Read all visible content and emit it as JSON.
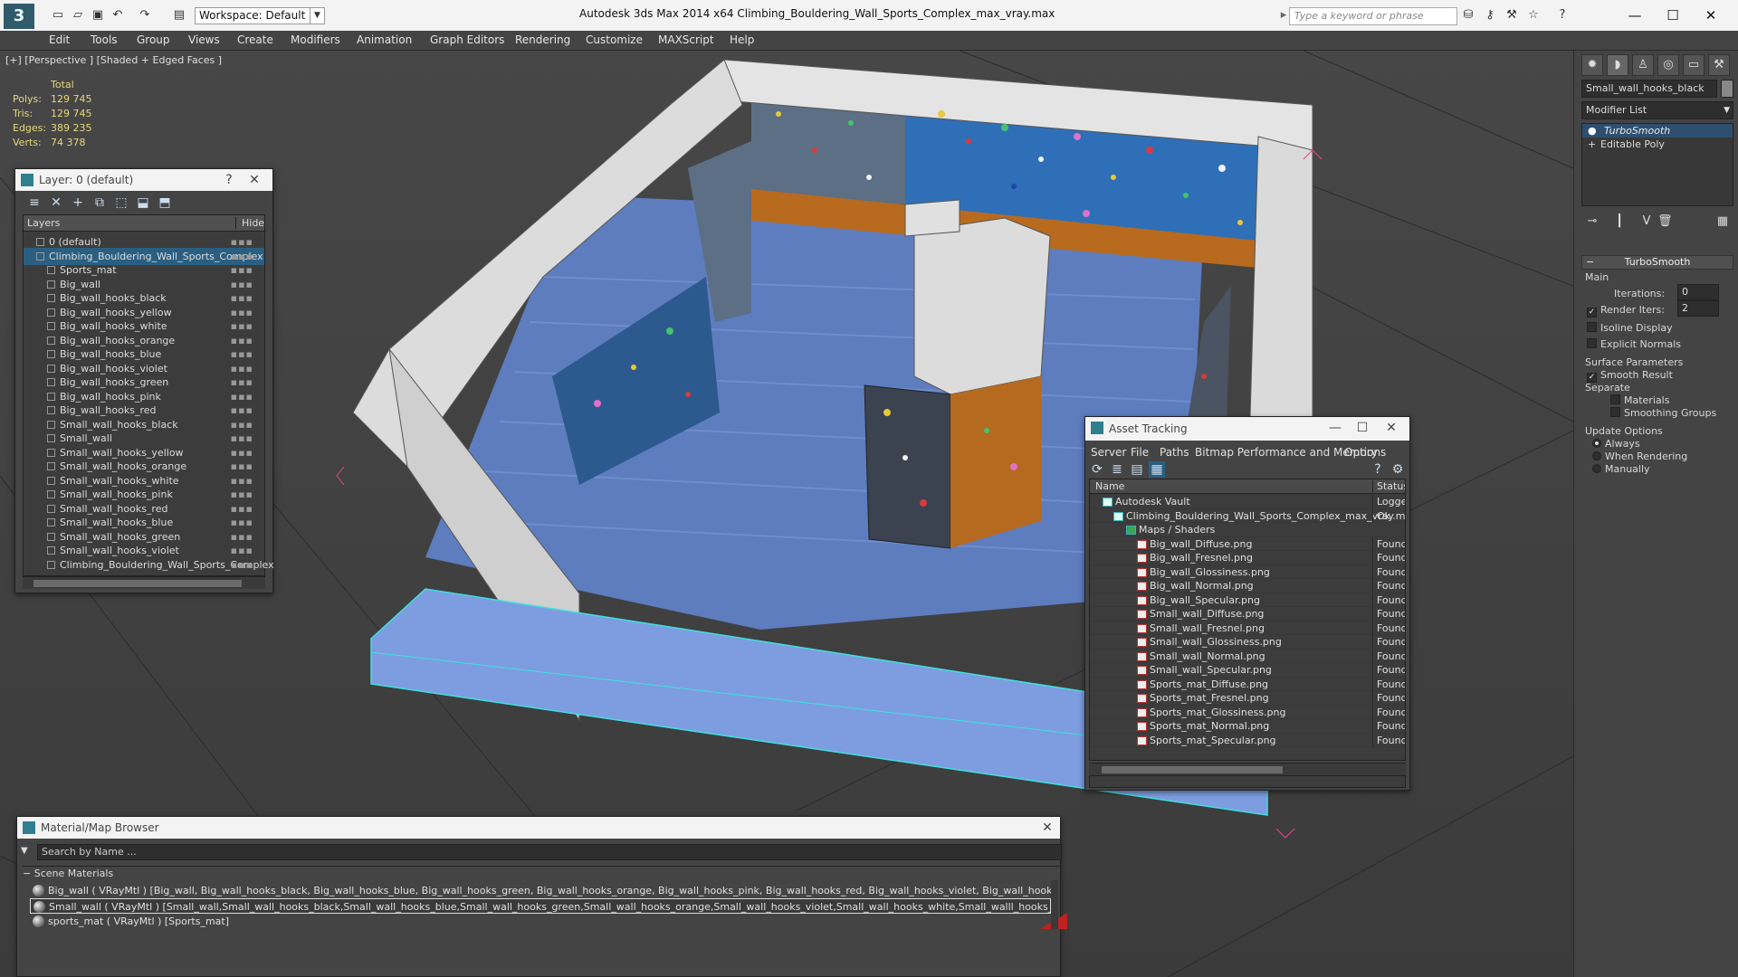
{
  "app": {
    "workspace": "Workspace: Default",
    "title": "Autodesk 3ds Max  2014 x64     Climbing_Bouldering_Wall_Sports_Complex_max_vray.max",
    "search_placeholder": "Type a keyword or phrase"
  },
  "menu": [
    "Edit",
    "Tools",
    "Group",
    "Views",
    "Create",
    "Modifiers",
    "Animation",
    "Graph Editors",
    "Rendering",
    "Customize",
    "MAXScript",
    "Help"
  ],
  "viewport": {
    "label": "[+] [Perspective ] [Shaded + Edged Faces ]",
    "stats": {
      "header": "Total",
      "rows": [
        {
          "label": "Polys:",
          "value": "129 745"
        },
        {
          "label": "Tris:",
          "value": "129 745"
        },
        {
          "label": "Edges:",
          "value": "389 235"
        },
        {
          "label": "Verts:",
          "value": "74 378"
        }
      ]
    }
  },
  "layers": {
    "title": "Layer: 0 (default)",
    "help": "?",
    "col_layers": "Layers",
    "col_hide": "Hide",
    "items": [
      {
        "name": "0 (default)",
        "level": 0
      },
      {
        "name": "Climbing_Bouldering_Wall_Sports_Complex",
        "level": 0,
        "selected": true
      },
      {
        "name": "Sports_mat",
        "level": 1
      },
      {
        "name": "Big_wall",
        "level": 1
      },
      {
        "name": "Big_wall_hooks_black",
        "level": 1
      },
      {
        "name": "Big_wall_hooks_yellow",
        "level": 1
      },
      {
        "name": "Big_wall_hooks_white",
        "level": 1
      },
      {
        "name": "Big_wall_hooks_orange",
        "level": 1
      },
      {
        "name": "Big_wall_hooks_blue",
        "level": 1
      },
      {
        "name": "Big_wall_hooks_violet",
        "level": 1
      },
      {
        "name": "Big_wall_hooks_green",
        "level": 1
      },
      {
        "name": "Big_wall_hooks_pink",
        "level": 1
      },
      {
        "name": "Big_wall_hooks_red",
        "level": 1
      },
      {
        "name": "Small_wall_hooks_black",
        "level": 1
      },
      {
        "name": "Small_wall",
        "level": 1
      },
      {
        "name": "Small_wall_hooks_yellow",
        "level": 1
      },
      {
        "name": "Small_wall_hooks_orange",
        "level": 1
      },
      {
        "name": "Small_wall_hooks_white",
        "level": 1
      },
      {
        "name": "Small_wall_hooks_pink",
        "level": 1
      },
      {
        "name": "Small_wall_hooks_red",
        "level": 1
      },
      {
        "name": "Small_wall_hooks_blue",
        "level": 1
      },
      {
        "name": "Small_wall_hooks_green",
        "level": 1
      },
      {
        "name": "Small_wall_hooks_violet",
        "level": 1
      },
      {
        "name": "Climbing_Bouldering_Wall_Sports_Complex",
        "level": 1
      }
    ]
  },
  "command_panel": {
    "object_name": "Small_wall_hooks_black",
    "modifier_list": "Modifier List",
    "stack": [
      "TurboSmooth",
      "Editable Poly"
    ],
    "rollout": "TurboSmooth",
    "main": "Main",
    "iterations_label": "Iterations:",
    "iterations": "0",
    "render_iters_label": "Render Iters:",
    "render_iters": "2",
    "isoline": "Isoline Display",
    "explicit": "Explicit Normals",
    "surface": "Surface Parameters",
    "smooth_result": "Smooth Result",
    "separate": "Separate",
    "materials": "Materials",
    "smoothing_groups": "Smoothing Groups",
    "update": "Update Options",
    "always": "Always",
    "when_rendering": "When Rendering",
    "manually": "Manually"
  },
  "material_browser": {
    "title": "Material/Map Browser",
    "search": "Search by Name ...",
    "group": "Scene Materials",
    "items": [
      "Big_wall  ( VRayMtl ) [Big_wall, Big_wall_hooks_black, Big_wall_hooks_blue, Big_wall_hooks_green, Big_wall_hooks_orange, Big_wall_hooks_pink, Big_wall_hooks_red, Big_wall_hooks_violet, Big_wall_hooks_white, Big_wall_hooks_yellow]",
      "Small_wall  ( VRayMtl ) [Small_wall,Small_wall_hooks_black,Small_wall_hooks_blue,Small_wall_hooks_green,Small_wall_hooks_orange,Small_wall_hooks_violet,Small_wall_hooks_white,Small_walll_hooks_pink,Small_walll_hooks_yellow,Smalll_wall_hooks_red]",
      "sports_mat  ( VRayMtl ) [Sports_mat]"
    ]
  },
  "asset_tracking": {
    "title": "Asset Tracking",
    "menu": [
      "Server",
      "File",
      "Paths",
      "Bitmap Performance and Memory",
      "Options"
    ],
    "col_name": "Name",
    "col_status": "Status",
    "rows": [
      {
        "name": "Autodesk Vault",
        "status": "Logged Out",
        "level": 1,
        "kind": "vault"
      },
      {
        "name": "Climbing_Bouldering_Wall_Sports_Complex_max_vray.max",
        "status": "Ok",
        "level": 2,
        "kind": "max"
      },
      {
        "name": "Maps / Shaders",
        "status": "",
        "level": 3,
        "kind": "folder"
      },
      {
        "name": "Big_wall_Diffuse.png",
        "status": "Found",
        "level": 4,
        "kind": "png"
      },
      {
        "name": "Big_wall_Fresnel.png",
        "status": "Found",
        "level": 4,
        "kind": "png"
      },
      {
        "name": "Big_wall_Glossiness.png",
        "status": "Found",
        "level": 4,
        "kind": "png"
      },
      {
        "name": "Big_wall_Normal.png",
        "status": "Found",
        "level": 4,
        "kind": "png"
      },
      {
        "name": "Big_wall_Specular.png",
        "status": "Found",
        "level": 4,
        "kind": "png"
      },
      {
        "name": "Small_wall_Diffuse.png",
        "status": "Found",
        "level": 4,
        "kind": "png"
      },
      {
        "name": "Small_wall_Fresnel.png",
        "status": "Found",
        "level": 4,
        "kind": "png"
      },
      {
        "name": "Small_wall_Glossiness.png",
        "status": "Found",
        "level": 4,
        "kind": "png"
      },
      {
        "name": "Small_wall_Normal.png",
        "status": "Found",
        "level": 4,
        "kind": "png"
      },
      {
        "name": "Small_wall_Specular.png",
        "status": "Found",
        "level": 4,
        "kind": "png"
      },
      {
        "name": "Sports_mat_Diffuse.png",
        "status": "Found",
        "level": 4,
        "kind": "png"
      },
      {
        "name": "Sports_mat_Fresnel.png",
        "status": "Found",
        "level": 4,
        "kind": "png"
      },
      {
        "name": "Sports_mat_Glossiness.png",
        "status": "Found",
        "level": 4,
        "kind": "png"
      },
      {
        "name": "Sports_mat_Normal.png",
        "status": "Found",
        "level": 4,
        "kind": "png"
      },
      {
        "name": "Sports_mat_Specular.png",
        "status": "Found",
        "level": 4,
        "kind": "png"
      }
    ]
  }
}
